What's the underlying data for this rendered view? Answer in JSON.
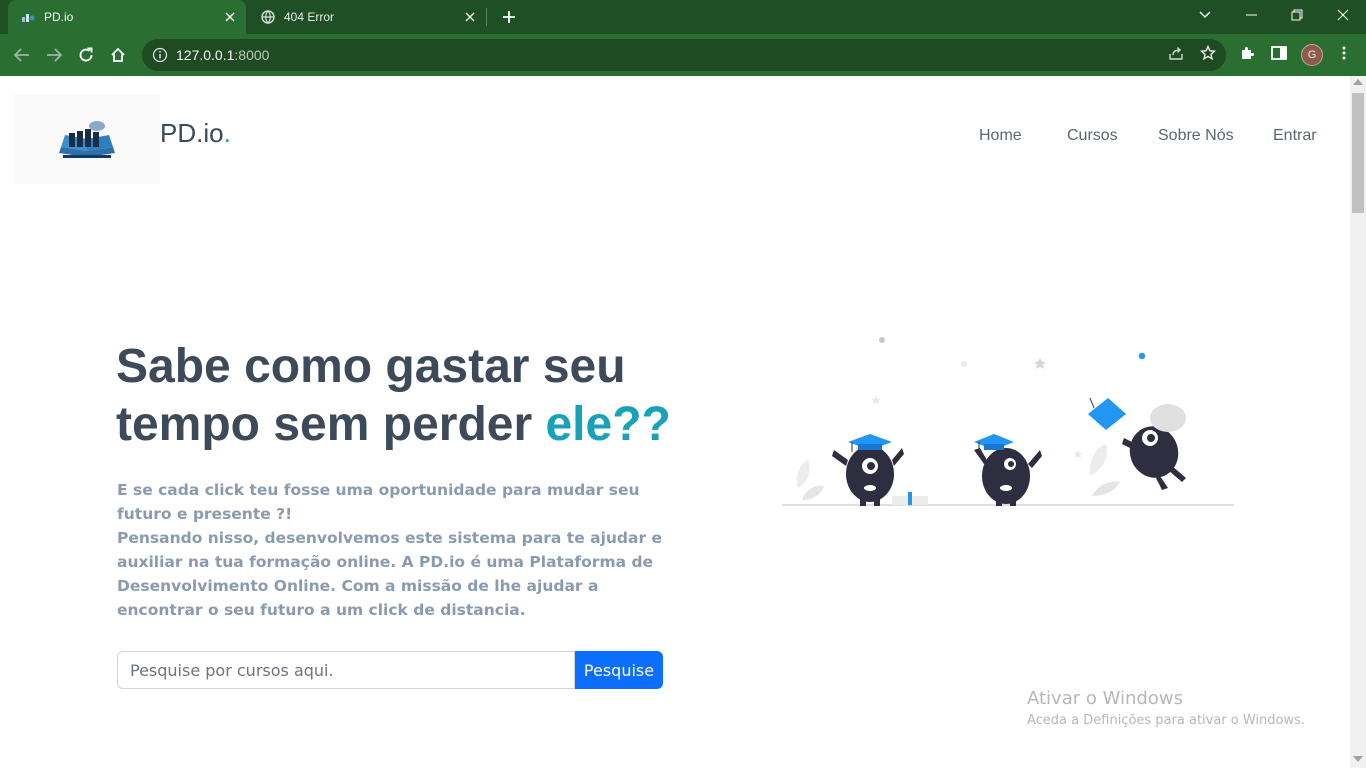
{
  "browser": {
    "tabs": [
      {
        "title": "PD.io",
        "active": true
      },
      {
        "title": "404 Error",
        "active": false
      }
    ],
    "url_host": "127.0.0.1",
    "url_port": ":8000",
    "profile_initial": "G"
  },
  "site": {
    "brand_name": "PD.io",
    "brand_dot": ".",
    "nav": [
      "Home",
      "Cursos",
      "Sobre Nós",
      "Entrar"
    ]
  },
  "hero": {
    "title_line1": "Sabe como gastar seu",
    "title_line2_prefix": "tempo sem perder ",
    "title_accent": "ele??",
    "paragraph1": "E se cada click teu fosse uma oportunidade para mudar seu futuro e presente ?!",
    "paragraph2": "Pensando nisso, desenvolvemos este sistema para te ajudar e auxiliar na tua formação online. A PD.io é uma Plataforma de Desenvolvimento Online. Com a missão de lhe ajudar a encontrar o seu futuro a um click de distancia.",
    "search_placeholder": "Pesquise por cursos aqui.",
    "search_button": "Pesquise"
  },
  "windows_watermark": {
    "title": "Ativar o Windows",
    "subtitle": "Aceda a Definições para ativar o Windows."
  },
  "colors": {
    "accent": "#17a2b8",
    "primary_button": "#0d6efd",
    "chrome_dark": "#1f4f24",
    "chrome_light": "#2b6e31"
  }
}
